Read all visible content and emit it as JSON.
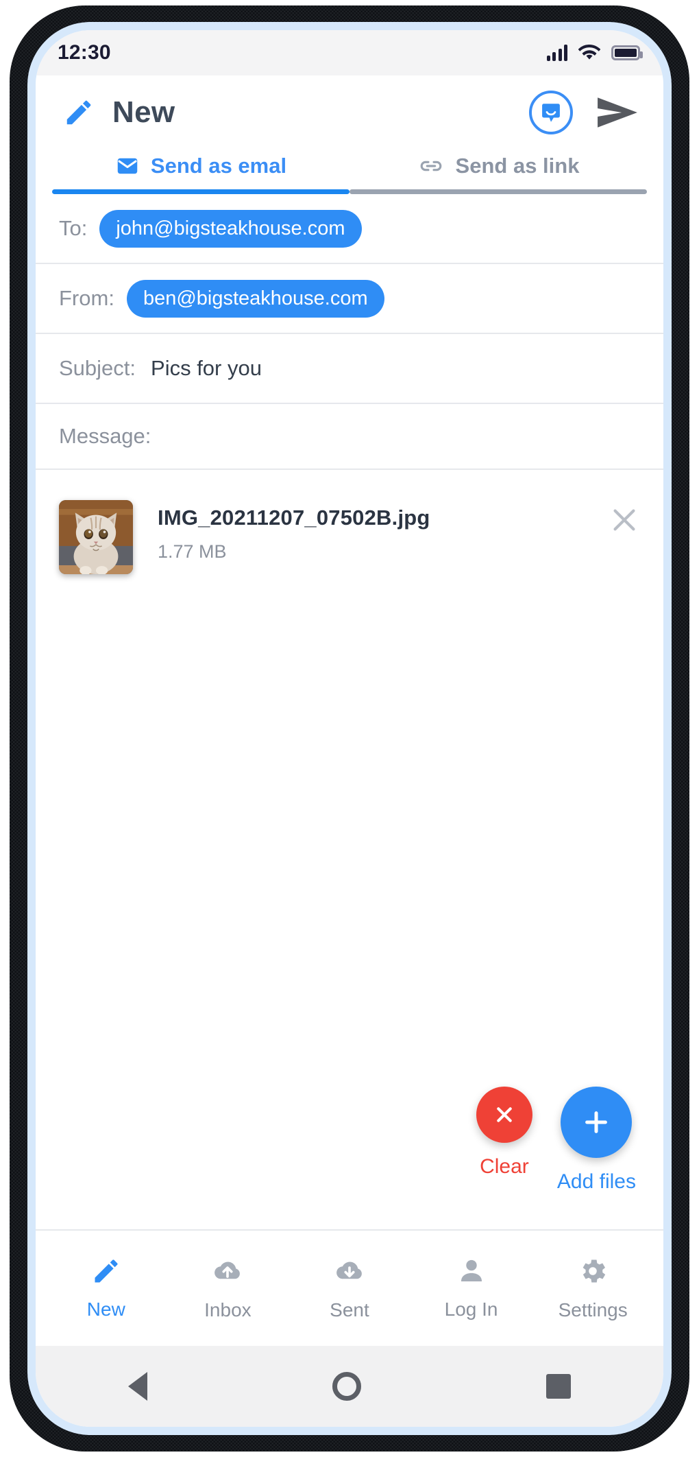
{
  "status_bar": {
    "time": "12:30",
    "icons": [
      "signal-bars-icon",
      "wifi-icon",
      "battery-icon"
    ]
  },
  "app_bar": {
    "icon": "pencil-icon",
    "title": "New",
    "actions": [
      {
        "name": "chat-bubble-icon",
        "label": ""
      },
      {
        "name": "send-icon",
        "label": ""
      }
    ]
  },
  "tabs": [
    {
      "label": "Send as emal",
      "icon": "envelope-icon",
      "active": true
    },
    {
      "label": "Send as link",
      "icon": "link-icon",
      "active": false
    }
  ],
  "fields": {
    "to": {
      "label": "To:",
      "chip": "john@bigsteakhouse.com"
    },
    "from": {
      "label": "From:",
      "chip": "ben@bigsteakhouse.com"
    },
    "subject": {
      "label": "Subject:",
      "value": "Pics for you"
    },
    "message": {
      "label": "Message:",
      "value": ""
    }
  },
  "attachments": [
    {
      "name": "IMG_20211207_07502B.jpg",
      "size": "1.77 MB",
      "thumb_alt": "kitten-photo",
      "remove_icon": "close-icon"
    }
  ],
  "fabs": [
    {
      "label": "Clear",
      "icon": "close-icon",
      "color": "#ef4136"
    },
    {
      "label": "Add files",
      "icon": "plus-icon",
      "color": "#2f8df5"
    }
  ],
  "bottom_nav": [
    {
      "label": "New",
      "icon": "pencil-icon",
      "active": true
    },
    {
      "label": "Inbox",
      "icon": "cloud-upload-icon",
      "active": false
    },
    {
      "label": "Sent",
      "icon": "cloud-download-icon",
      "active": false
    },
    {
      "label": "Log In",
      "icon": "person-icon",
      "active": false
    },
    {
      "label": "Settings",
      "icon": "gear-icon",
      "active": false
    }
  ],
  "system_bar": [
    {
      "name": "back-button"
    },
    {
      "name": "home-button"
    },
    {
      "name": "recents-button"
    }
  ],
  "colors": {
    "accent": "#2f8df5",
    "danger": "#ef4136",
    "muted": "#8b919c",
    "bezel": "#d6e8fb"
  }
}
